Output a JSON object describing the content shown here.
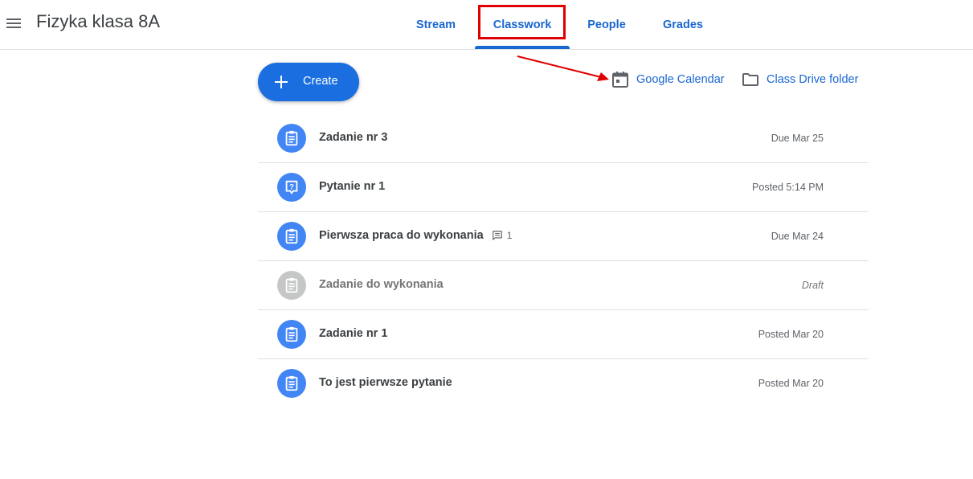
{
  "header": {
    "class_title": "Fizyka klasa 8A",
    "tabs": [
      {
        "label": "Stream"
      },
      {
        "label": "Classwork"
      },
      {
        "label": "People"
      },
      {
        "label": "Grades"
      }
    ],
    "active_tab": "Classwork"
  },
  "toolbar": {
    "create_label": "Create",
    "calendar_label": "Google Calendar",
    "drive_label": "Class Drive folder"
  },
  "items": [
    {
      "title": "Zadanie nr 3",
      "meta": "Due Mar 25",
      "icon": "assignment-icon"
    },
    {
      "title": "Pytanie nr 1",
      "meta": "Posted 5:14 PM",
      "icon": "question-icon"
    },
    {
      "title": "Pierwsza praca do wykonania",
      "meta": "Due Mar 24",
      "icon": "assignment-icon",
      "comments": "1"
    },
    {
      "title": "Zadanie do wykonania",
      "meta": "Draft",
      "icon": "assignment-icon",
      "draft": true
    },
    {
      "title": "Zadanie nr 1",
      "meta": "Posted Mar 20",
      "icon": "assignment-icon"
    },
    {
      "title": "To jest pierwsze pytanie",
      "meta": "Posted Mar 20",
      "icon": "assignment-icon"
    }
  ],
  "colors": {
    "accent": "#1967d2",
    "create_button": "#1a6ee0",
    "item_icon": "#4285f4",
    "draft_icon": "#c4c7c5",
    "annotation_red": "#e00000"
  }
}
